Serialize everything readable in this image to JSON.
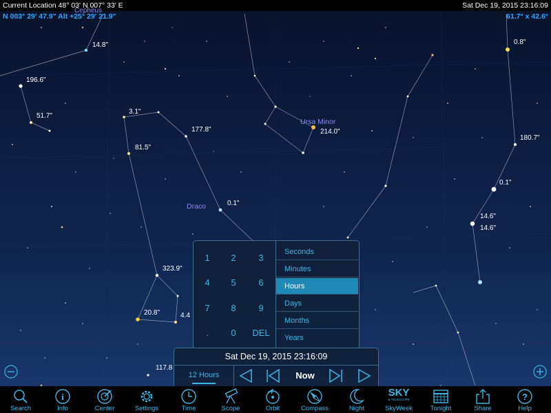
{
  "header": {
    "location": "Current Location  48° 03' N 007° 33' E",
    "datetime": "Sat Dec 19, 2015   23:16:09",
    "pointing": "N 003° 29' 47.9\" Alt +25° 29' 21.9\"",
    "fov": "61.7° x 42.6°",
    "cepheus_partial": "Cepheus"
  },
  "sky": {
    "constellations": {
      "ursa_minor": "Ursa Minor",
      "draco": "Draco"
    },
    "labels": {
      "l148a": "14.8\"",
      "l1966": "196.6\"",
      "l517": "51.7\"",
      "l31": "3.1\"",
      "l815": "81.5\"",
      "l1778": "177.8\"",
      "l2140": "214.0\"",
      "l01a": "0.1\"",
      "l08": "0.8\"",
      "l1807": "180.7\"",
      "l01b": "0.1\"",
      "l146a": "14.6\"",
      "l146b": "14.6\"",
      "l3239": "323.9\"",
      "l208": "20.8\"",
      "l44": "4.4",
      "l1178": "117.8"
    }
  },
  "keypad": {
    "keys": [
      "1",
      "2",
      "3",
      "4",
      "5",
      "6",
      "7",
      "8",
      "9",
      ".",
      "0",
      "DEL"
    ]
  },
  "units": [
    "Seconds",
    "Minutes",
    "Hours",
    "Days",
    "Months",
    "Years"
  ],
  "selected_unit": "Hours",
  "time_control": {
    "datetime": "Sat Dec 19, 2015    23:16:09",
    "step": "12 Hours",
    "now": "Now"
  },
  "toolbar": {
    "items": [
      "Search",
      "Info",
      "Center",
      "Settings",
      "Time",
      "Scope",
      "Orbit",
      "Compass",
      "Night",
      "SkyWeek",
      "Tonight",
      "Share",
      "Help"
    ],
    "sky_logo": "SKY",
    "sky_logo_sub": "& TELESCOPE"
  },
  "colors": {
    "accent": "#3fb6e8",
    "selected": "#1f8ab8",
    "coords": "#2ea8ff",
    "constellation_label": "#8b8cf5"
  }
}
